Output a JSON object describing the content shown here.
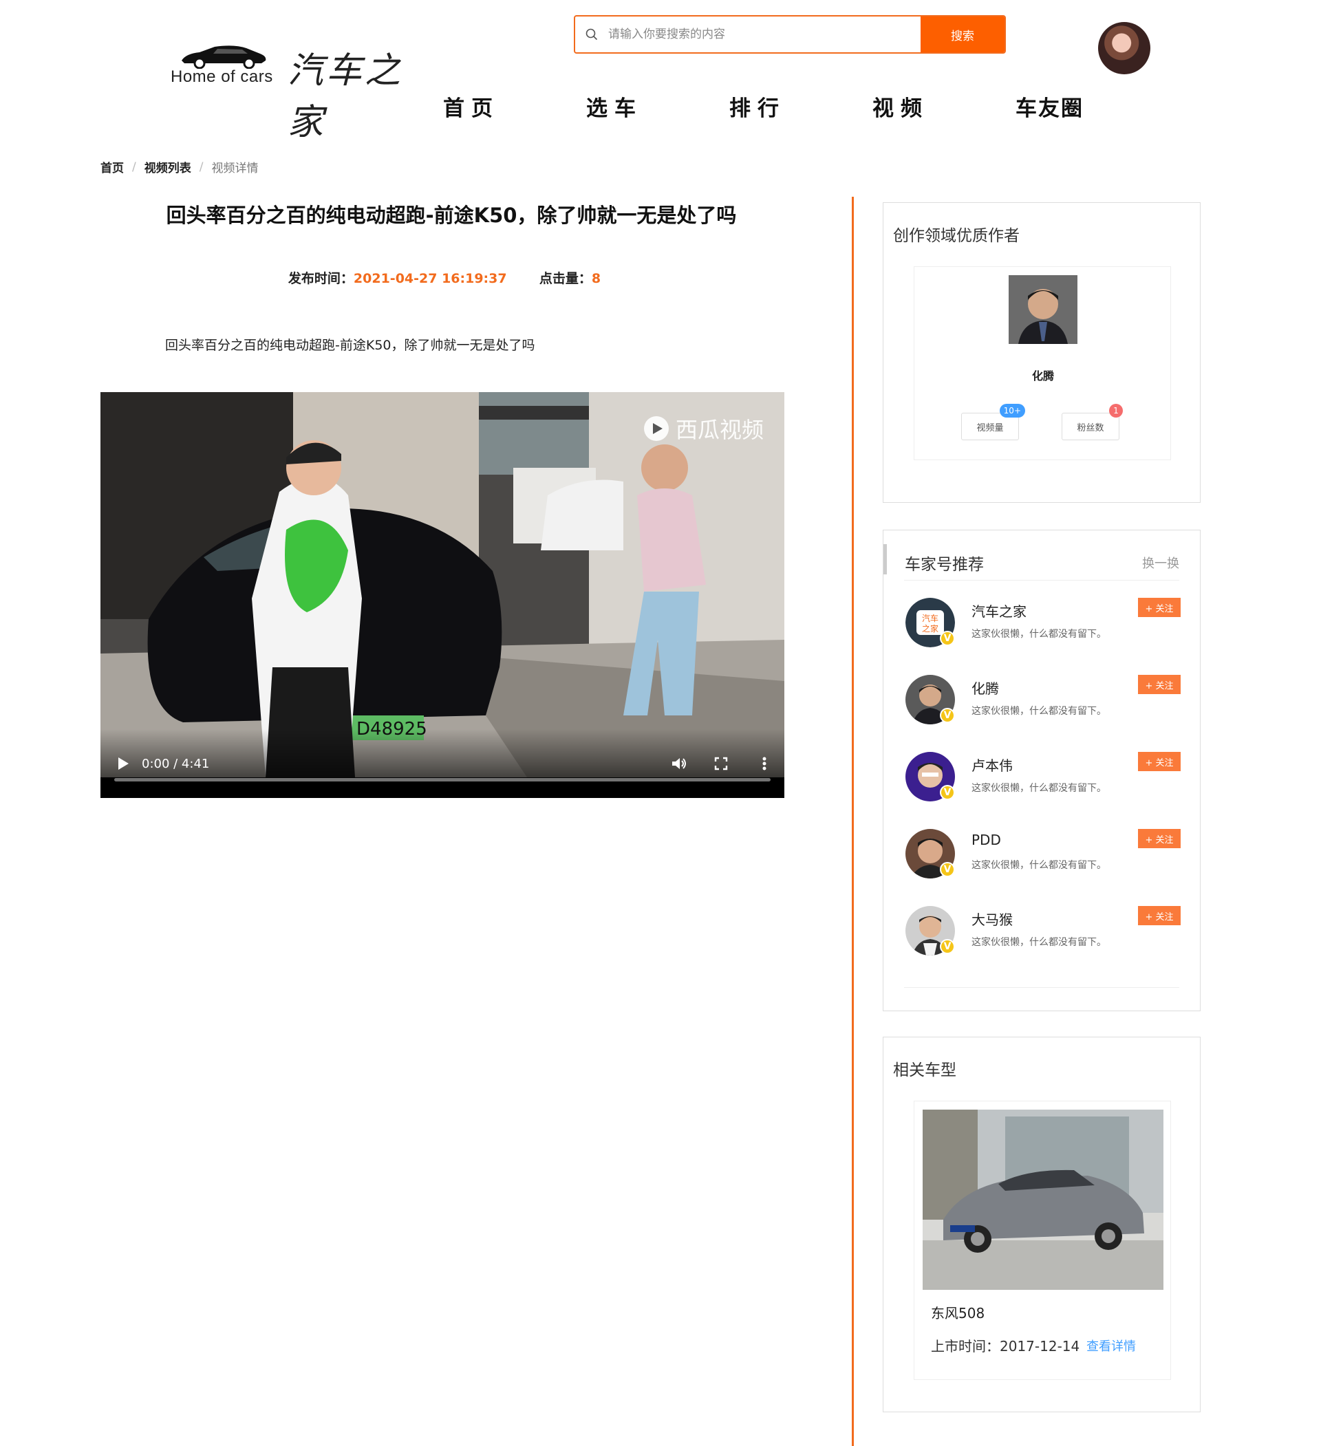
{
  "logo": {
    "en": "Home of cars",
    "cn": "汽车之家"
  },
  "search": {
    "placeholder": "请输入你要搜索的内容",
    "button_label": "搜索"
  },
  "nav": {
    "items": [
      "首页",
      "选车",
      "排行",
      "视频",
      "车友圈"
    ]
  },
  "breadcrumb": {
    "home": "首页",
    "sep": "/",
    "list": "视频列表",
    "current": "视频详情"
  },
  "article": {
    "title": "回头率百分之百的纯电动超跑-前途K50，除了帅就一无是处了吗",
    "publish_label": "发布时间：",
    "publish_time": "2021-04-27 16:19:37",
    "clicks_label": "点击量：",
    "clicks": "8",
    "description": "回头率百分之百的纯电动超跑-前途K50，除了帅就一无是处了吗"
  },
  "video": {
    "watermark": "西瓜视频",
    "time": "0:00 / 4:41",
    "progress": 0,
    "plate": "D48925"
  },
  "author_card": {
    "title": "创作领域优质作者",
    "name": "化腾",
    "videos_label": "视频量",
    "videos_badge": "10+",
    "fans_label": "粉丝数",
    "fans_badge": "1"
  },
  "recommend": {
    "title": "车家号推荐",
    "refresh": "换一换",
    "follow_label": "+ 关注",
    "items": [
      {
        "name": "汽车之家",
        "sub": "这家伙很懒，什么都没有留下。"
      },
      {
        "name": "化腾",
        "sub": "这家伙很懒，什么都没有留下。"
      },
      {
        "name": "卢本伟",
        "sub": "这家伙很懒，什么都没有留下。"
      },
      {
        "name": "PDD",
        "sub": "这家伙很懒，什么都没有留下。"
      },
      {
        "name": "大马猴",
        "sub": "这家伙很懒，什么都没有留下。"
      }
    ]
  },
  "model_card": {
    "title": "相关车型",
    "name": "东风508",
    "date_label": "上市时间：",
    "date": "2017-12-14",
    "link": "查看详情"
  },
  "colors": {
    "accent": "#f26b1d",
    "search_button": "#fd5f00",
    "follow": "#fa7a3a",
    "link": "#409eff"
  }
}
